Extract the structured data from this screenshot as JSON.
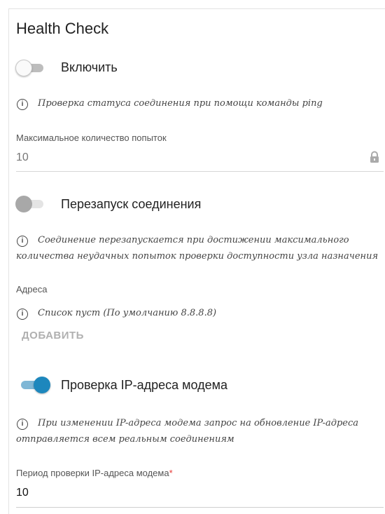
{
  "section": {
    "title": "Health Check"
  },
  "enable": {
    "label": "Включить",
    "state": "off"
  },
  "ping_info": "Проверка статуса соединения при помощи команды ping",
  "max_attempts": {
    "label": "Максимальное количество попыток",
    "value": "10",
    "locked": true
  },
  "restart": {
    "label": "Перезапуск соединения",
    "state": "disabled"
  },
  "restart_info": {
    "line1": "Соединение перезапускается при достижении максимального",
    "line2": "количества неудачных попыток проверки доступности узла назначения"
  },
  "addresses": {
    "label": "Адреса",
    "empty_info": "Список пуст (По умолчанию 8.8.8.8)",
    "add_label": "ДОБАВИТЬ"
  },
  "modem_ip_check": {
    "label": "Проверка IP-адреса модема",
    "state": "on"
  },
  "modem_info": {
    "line1": "При изменении IP-адреса модема запрос на обновление IP-адреса",
    "line2": "отправляется всем реальным соединениям"
  },
  "check_period": {
    "label": "Период проверки IP-адреса модема",
    "required_mark": "*",
    "value": "10"
  },
  "colors": {
    "accent": "#1d87bd",
    "required": "#e53935",
    "text": "#212121"
  },
  "icons": {
    "info": "info-icon",
    "lock": "lock-icon"
  }
}
